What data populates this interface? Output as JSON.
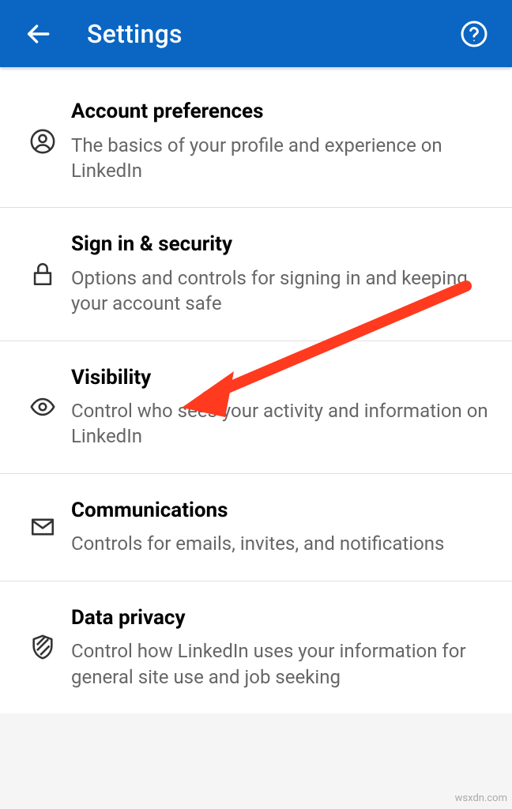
{
  "header": {
    "title": "Settings"
  },
  "rows": [
    {
      "title": "Account preferences",
      "desc": "The basics of your profile and experience on LinkedIn"
    },
    {
      "title": "Sign in & security",
      "desc": "Options and controls for signing in and keeping your account safe"
    },
    {
      "title": "Visibility",
      "desc": "Control who sees your activity and information on LinkedIn"
    },
    {
      "title": "Communications",
      "desc": "Controls for emails, invites, and notifications"
    },
    {
      "title": "Data privacy",
      "desc": "Control how LinkedIn uses your information for general site use and job seeking"
    }
  ],
  "watermark": "wsxdn.com"
}
